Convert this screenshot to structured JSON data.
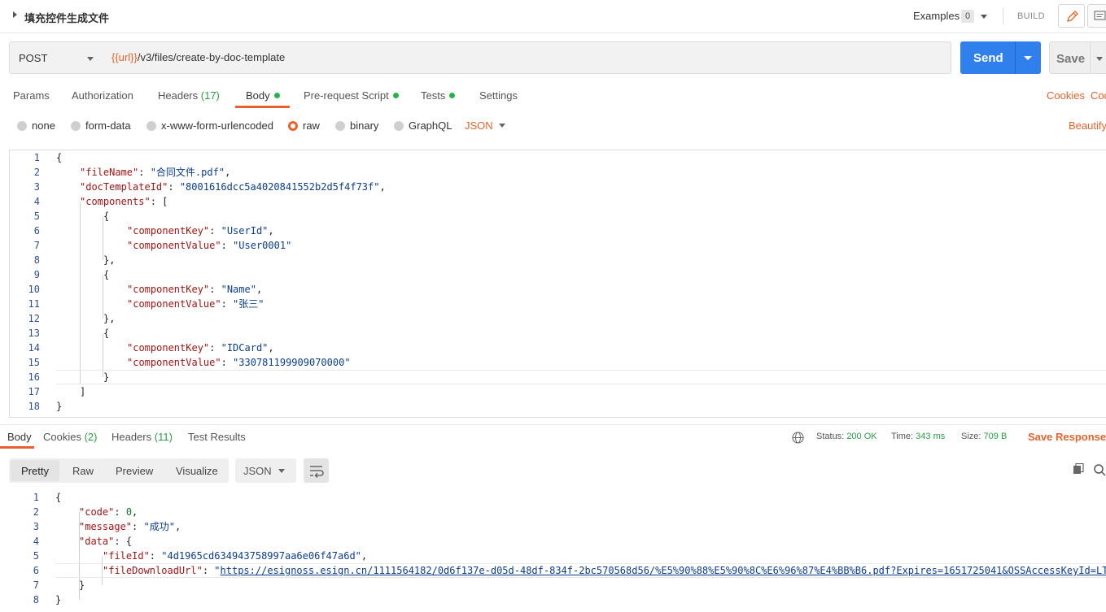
{
  "header": {
    "request_name": "填充控件生成文件",
    "examples_label": "Examples",
    "examples_count": "0",
    "build_label": "BUILD"
  },
  "request": {
    "method": "POST",
    "url_var": "{{url}}",
    "url_path": "/v3/files/create-by-doc-template",
    "send_label": "Send",
    "save_label": "Save"
  },
  "tabs": {
    "params": "Params",
    "authorization": "Authorization",
    "headers": "Headers",
    "headers_count": "(17)",
    "body": "Body",
    "prerequest": "Pre-request Script",
    "tests": "Tests",
    "settings": "Settings",
    "cookies": "Cookies",
    "code": "Code"
  },
  "body_types": {
    "none": "none",
    "form_data": "form-data",
    "urlencoded": "x-www-form-urlencoded",
    "raw": "raw",
    "binary": "binary",
    "graphql": "GraphQL",
    "format": "JSON",
    "beautify": "Beautify"
  },
  "request_body": {
    "line_numbers": [
      "1",
      "2",
      "3",
      "4",
      "5",
      "6",
      "7",
      "8",
      "9",
      "10",
      "11",
      "12",
      "13",
      "14",
      "15",
      "16",
      "17",
      "18"
    ],
    "lines": [
      {
        "p": "{"
      },
      {
        "k": "\"fileName\"",
        "p": ": ",
        "s": "\"合同文件.pdf\"",
        "t": ","
      },
      {
        "k": "\"docTemplateId\"",
        "p": ": ",
        "s": "\"8001616dcc5a4020841552b2d5f4f73f\"",
        "t": ","
      },
      {
        "k": "\"components\"",
        "p": ": ["
      },
      {
        "p": "{"
      },
      {
        "k": "\"componentKey\"",
        "p": ": ",
        "s": "\"UserId\"",
        "t": ","
      },
      {
        "k": "\"componentValue\"",
        "p": ": ",
        "s": "\"User0001\""
      },
      {
        "p": "},"
      },
      {
        "p": "{"
      },
      {
        "k": "\"componentKey\"",
        "p": ": ",
        "s": "\"Name\"",
        "t": ","
      },
      {
        "k": "\"componentValue\"",
        "p": ": ",
        "s": "\"张三\""
      },
      {
        "p": "},"
      },
      {
        "p": "{"
      },
      {
        "k": "\"componentKey\"",
        "p": ": ",
        "s": "\"IDCard\"",
        "t": ","
      },
      {
        "k": "\"componentValue\"",
        "p": ": ",
        "s": "\"330781199909070000\""
      },
      {
        "p": "}"
      },
      {
        "p": "]"
      },
      {
        "p": "}"
      }
    ]
  },
  "response_tabs": {
    "body": "Body",
    "cookies": "Cookies",
    "cookies_count": "(2)",
    "headers": "Headers",
    "headers_count": "(11)",
    "test_results": "Test Results"
  },
  "response_status": {
    "status_label": "Status:",
    "status_value": "200 OK",
    "time_label": "Time:",
    "time_value": "343 ms",
    "size_label": "Size:",
    "size_value": "709 B",
    "save_response": "Save Response"
  },
  "response_view": {
    "pretty": "Pretty",
    "raw": "Raw",
    "preview": "Preview",
    "visualize": "Visualize",
    "format": "JSON"
  },
  "response_body": {
    "line_numbers": [
      "1",
      "2",
      "3",
      "4",
      "5",
      "6",
      "7",
      "8"
    ],
    "lines": [
      {
        "p": "{"
      },
      {
        "k": "\"code\"",
        "p": ": ",
        "n": "0",
        "t": ","
      },
      {
        "k": "\"message\"",
        "p": ": ",
        "s": "\"成功\"",
        "t": ","
      },
      {
        "k": "\"data\"",
        "p": ": {"
      },
      {
        "k": "\"fileId\"",
        "p": ": ",
        "s": "\"4d1965cd634943758997aa6e06f47a6d\"",
        "t": ","
      },
      {
        "k": "\"fileDownloadUrl\"",
        "p": ": ",
        "s": "\"",
        "u": "https://esignoss.esign.cn/1111564182/0d6f137e-d05d-48df-834f-2bc570568d56/%E5%90%88%E5%90%8C%E6%96%87%E4%BB%B6.pdf?Expires=1651725041&OSSAccessKeyId=LT"
      },
      {
        "p": "}"
      },
      {
        "p": "}"
      }
    ]
  },
  "colors": {
    "accent": "#e8632b",
    "send_blue": "#2f80ed",
    "status_green": "#2a9d48"
  }
}
